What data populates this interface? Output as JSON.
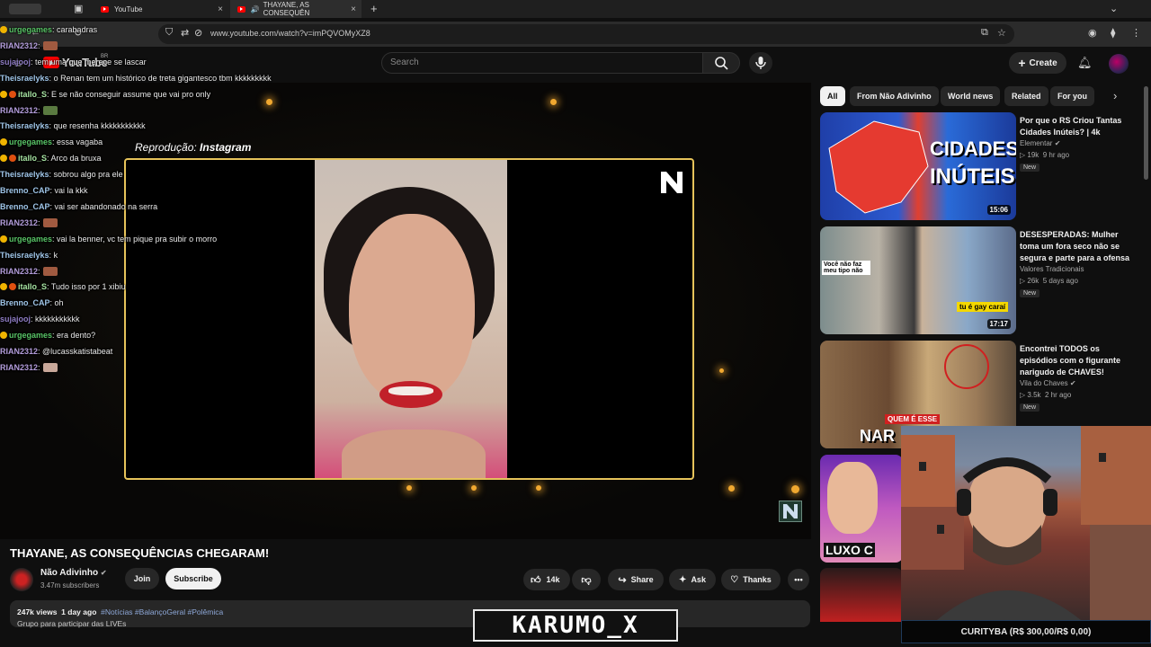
{
  "browser": {
    "tabs": [
      {
        "label": "YouTube",
        "active": false
      },
      {
        "label": "THAYANE, AS CONSEQUÊN",
        "active": true
      }
    ],
    "url": "www.youtube.com/watch?v=imPQVOMyXZ8",
    "new_tab_symbol": "+"
  },
  "youtube": {
    "logo_text": "YouTube",
    "country": "BR",
    "search_placeholder": "Search",
    "create_label": "Create"
  },
  "video": {
    "overlay_caption_prefix": "Reprodução: ",
    "overlay_caption_source": "Instagram",
    "title": "THAYANE, AS CONSEQUÊNCIAS CHEGARAM!",
    "channel": "Não Adivinho",
    "subscribers": "3.47m subscribers",
    "join_label": "Join",
    "subscribe_label": "Subscribe",
    "likes": "14k",
    "share_label": "Share",
    "ask_label": "Ask",
    "thanks_label": "Thanks",
    "views": "247k views",
    "age": "1 day ago",
    "tags": "#Notícias #BalançoGeral #Polêmica",
    "desc_line": "Grupo para participar das LIVEs"
  },
  "chat": [
    {
      "user": "urgegames",
      "text": "carabadras",
      "color": "#58c466",
      "badges": 1
    },
    {
      "user": "RIAN2312",
      "text": ":",
      "color": "#b39ddb",
      "emote": "#a05a40"
    },
    {
      "user": "sujajooj",
      "text": "tem uma que merece se lascar",
      "color": "#8e7cc3"
    },
    {
      "user": "Theisraelyks",
      "text": "o Renan tem um histórico de treta gigantesco tbm kkkkkkkkk",
      "color": "#9fc5e8"
    },
    {
      "user": "itallo_S",
      "text": "E se não conseguir assume que vai pro only",
      "color": "#a6e3a1",
      "badges": 2
    },
    {
      "user": "RIAN2312",
      "text": ":",
      "color": "#b39ddb",
      "emote": "#5a7a40"
    },
    {
      "user": "Theisraelyks",
      "text": "que resenha kkkkkkkkkkk",
      "color": "#9fc5e8"
    },
    {
      "user": "urgegames",
      "text": "essa vagaba",
      "color": "#58c466",
      "badges": 1
    },
    {
      "user": "itallo_S",
      "text": "Arco da bruxa",
      "color": "#a6e3a1",
      "badges": 2
    },
    {
      "user": "Theisraelyks",
      "text": "sobrou algo pra ele",
      "color": "#9fc5e8"
    },
    {
      "user": "Brenno_CAP",
      "text": "vai la kkk",
      "color": "#9fc5e8"
    },
    {
      "user": "Brenno_CAP",
      "text": "vai ser abandonado na serra",
      "color": "#9fc5e8"
    },
    {
      "user": "RIAN2312",
      "text": ":",
      "color": "#b39ddb",
      "emote": "#a05a40"
    },
    {
      "user": "urgegames",
      "text": "vai la benner, vc tem pique pra subir o morro",
      "color": "#58c466",
      "badges": 1
    },
    {
      "user": "Theisraelyks",
      "text": "k",
      "color": "#9fc5e8"
    },
    {
      "user": "RIAN2312",
      "text": ":",
      "color": "#b39ddb",
      "emote": "#a05a40"
    },
    {
      "user": "itallo_S",
      "text": "Tudo isso por 1 xibiu",
      "color": "#a6e3a1",
      "badges": 2
    },
    {
      "user": "Brenno_CAP",
      "text": "oh",
      "color": "#9fc5e8"
    },
    {
      "user": "sujajooj",
      "text": "kkkkkkkkkkk",
      "color": "#8e7cc3"
    },
    {
      "user": "urgegames",
      "text": "era dento?",
      "color": "#58c466",
      "badges": 1
    },
    {
      "user": "RIAN2312",
      "text": "@lucasskatistabeat",
      "color": "#b39ddb"
    },
    {
      "user": "RIAN2312",
      "text": ":",
      "color": "#b39ddb",
      "emote": "#c9a89a"
    }
  ],
  "chips": [
    "All",
    "From Não Adivinho",
    "World news",
    "Related",
    "For you"
  ],
  "recommendations": [
    {
      "title": "Por que o RS Criou Tantas Cidades Inúteis? | 4k",
      "channel": "Elementar",
      "verified": true,
      "views": "19k",
      "age": "9 hr ago",
      "badge": "New",
      "duration": "15:06",
      "thumb_text_1": "CIDADES",
      "thumb_text_2": "INÚTEIS?"
    },
    {
      "title": "DESESPERADAS: Mulher toma um fora seco não se segura e parte para a ofensa",
      "channel": "Valores Tradicionais",
      "verified": false,
      "views": "26k",
      "age": "5 days ago",
      "badge": "New",
      "duration": "17:17",
      "thumb_text_1": "Você não faz meu tipo não",
      "thumb_text_2": "tu é gay caraí"
    },
    {
      "title": "Encontrei TODOS os episódios com o figurante narigudo de CHAVES!",
      "channel": "Vila do Chaves",
      "verified": true,
      "views": "3.5k",
      "age": "2 hr ago",
      "badge": "New",
      "duration": "",
      "thumb_text_1": "QUEM É ESSE",
      "thumb_text_2": "NAR"
    },
    {
      "title": "",
      "channel": "",
      "views": "",
      "age": "",
      "badge": "",
      "duration": "",
      "thumb_text_1": "LUXO C",
      "thumb_text_2": ""
    }
  ],
  "overlay": {
    "streamer_tag": "KARUMO_X",
    "donation_text": "CURITYBA (R$ 300,00/R$ 0,00)"
  },
  "colors": {
    "youtube_red": "#ff0000",
    "frame_gold": "#e6c35a",
    "background": "#0f0f0f"
  }
}
